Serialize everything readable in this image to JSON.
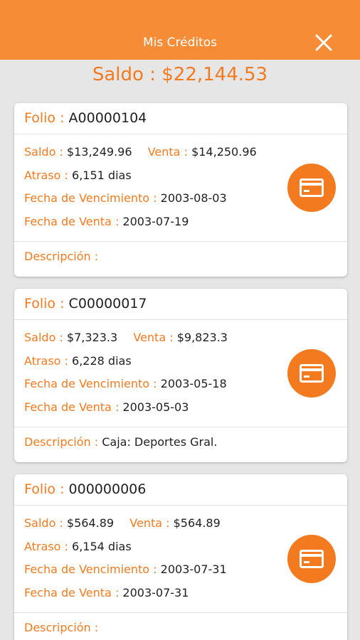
{
  "header": {
    "title": "Mis Créditos",
    "close_icon": "close-icon"
  },
  "balance": {
    "label": "Saldo : $22,144.53"
  },
  "colors": {
    "accent": "#f68c35",
    "label": "#f47a1f"
  },
  "labels": {
    "folio": "Folio :",
    "saldo": "Saldo :",
    "venta": "Venta :",
    "atraso": "Atraso :",
    "vencimiento": "Fecha de Vencimiento :",
    "fecha_venta": "Fecha de Venta :",
    "descripcion": "Descripción :"
  },
  "credits": [
    {
      "folio": "A00000104",
      "saldo": "$13,249.96",
      "venta": "$14,250.96",
      "atraso": "6,151 dias",
      "vencimiento": "2003-08-03",
      "fecha_venta": "2003-07-19",
      "descripcion": ""
    },
    {
      "folio": "C00000017",
      "saldo": "$7,323.3",
      "venta": "$9,823.3",
      "atraso": "6,228 dias",
      "vencimiento": "2003-05-18",
      "fecha_venta": "2003-05-03",
      "descripcion": "Caja: Deportes Gral."
    },
    {
      "folio": "000000006",
      "saldo": "$564.89",
      "venta": "$564.89",
      "atraso": "6,154 dias",
      "vencimiento": "2003-07-31",
      "fecha_venta": "2003-07-31",
      "descripcion": ""
    }
  ]
}
